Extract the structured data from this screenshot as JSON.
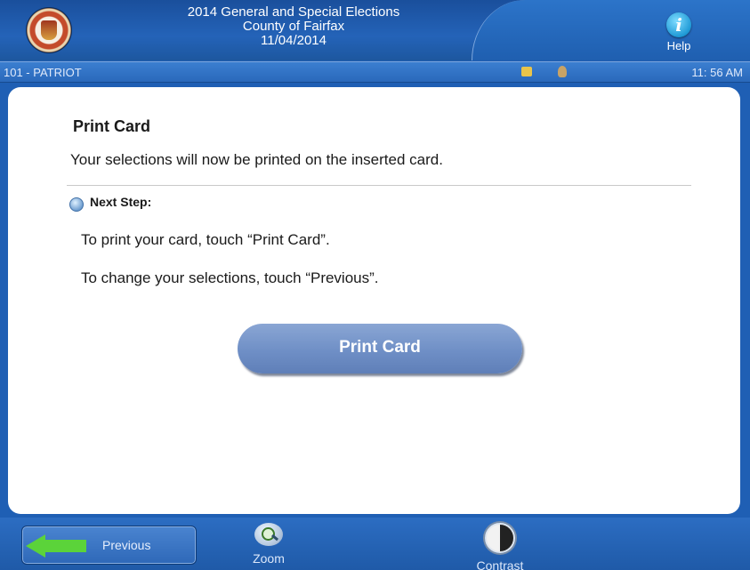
{
  "header": {
    "line1": "2014 General and Special Elections",
    "line2": "County of Fairfax",
    "line3": "11/04/2014",
    "help_label": "Help",
    "help_glyph": "i"
  },
  "statusbar": {
    "precinct": "101 - PATRIOT",
    "time": "11: 56 AM"
  },
  "content": {
    "title": "Print Card",
    "subtitle": "Your selections will now be printed on the inserted card.",
    "next_step_label": "Next Step:",
    "instruction_print": "To print your card, touch “Print Card”.",
    "instruction_change": "To change your selections, touch “Previous”.",
    "print_button_label": "Print Card"
  },
  "bottombar": {
    "previous_label": "Previous",
    "zoom_label": "Zoom",
    "contrast_label": "Contrast"
  },
  "colors": {
    "header_blue": "#1f5fb4",
    "button_blue": "#6f8fc6",
    "arrow_green": "#5bd33a"
  }
}
